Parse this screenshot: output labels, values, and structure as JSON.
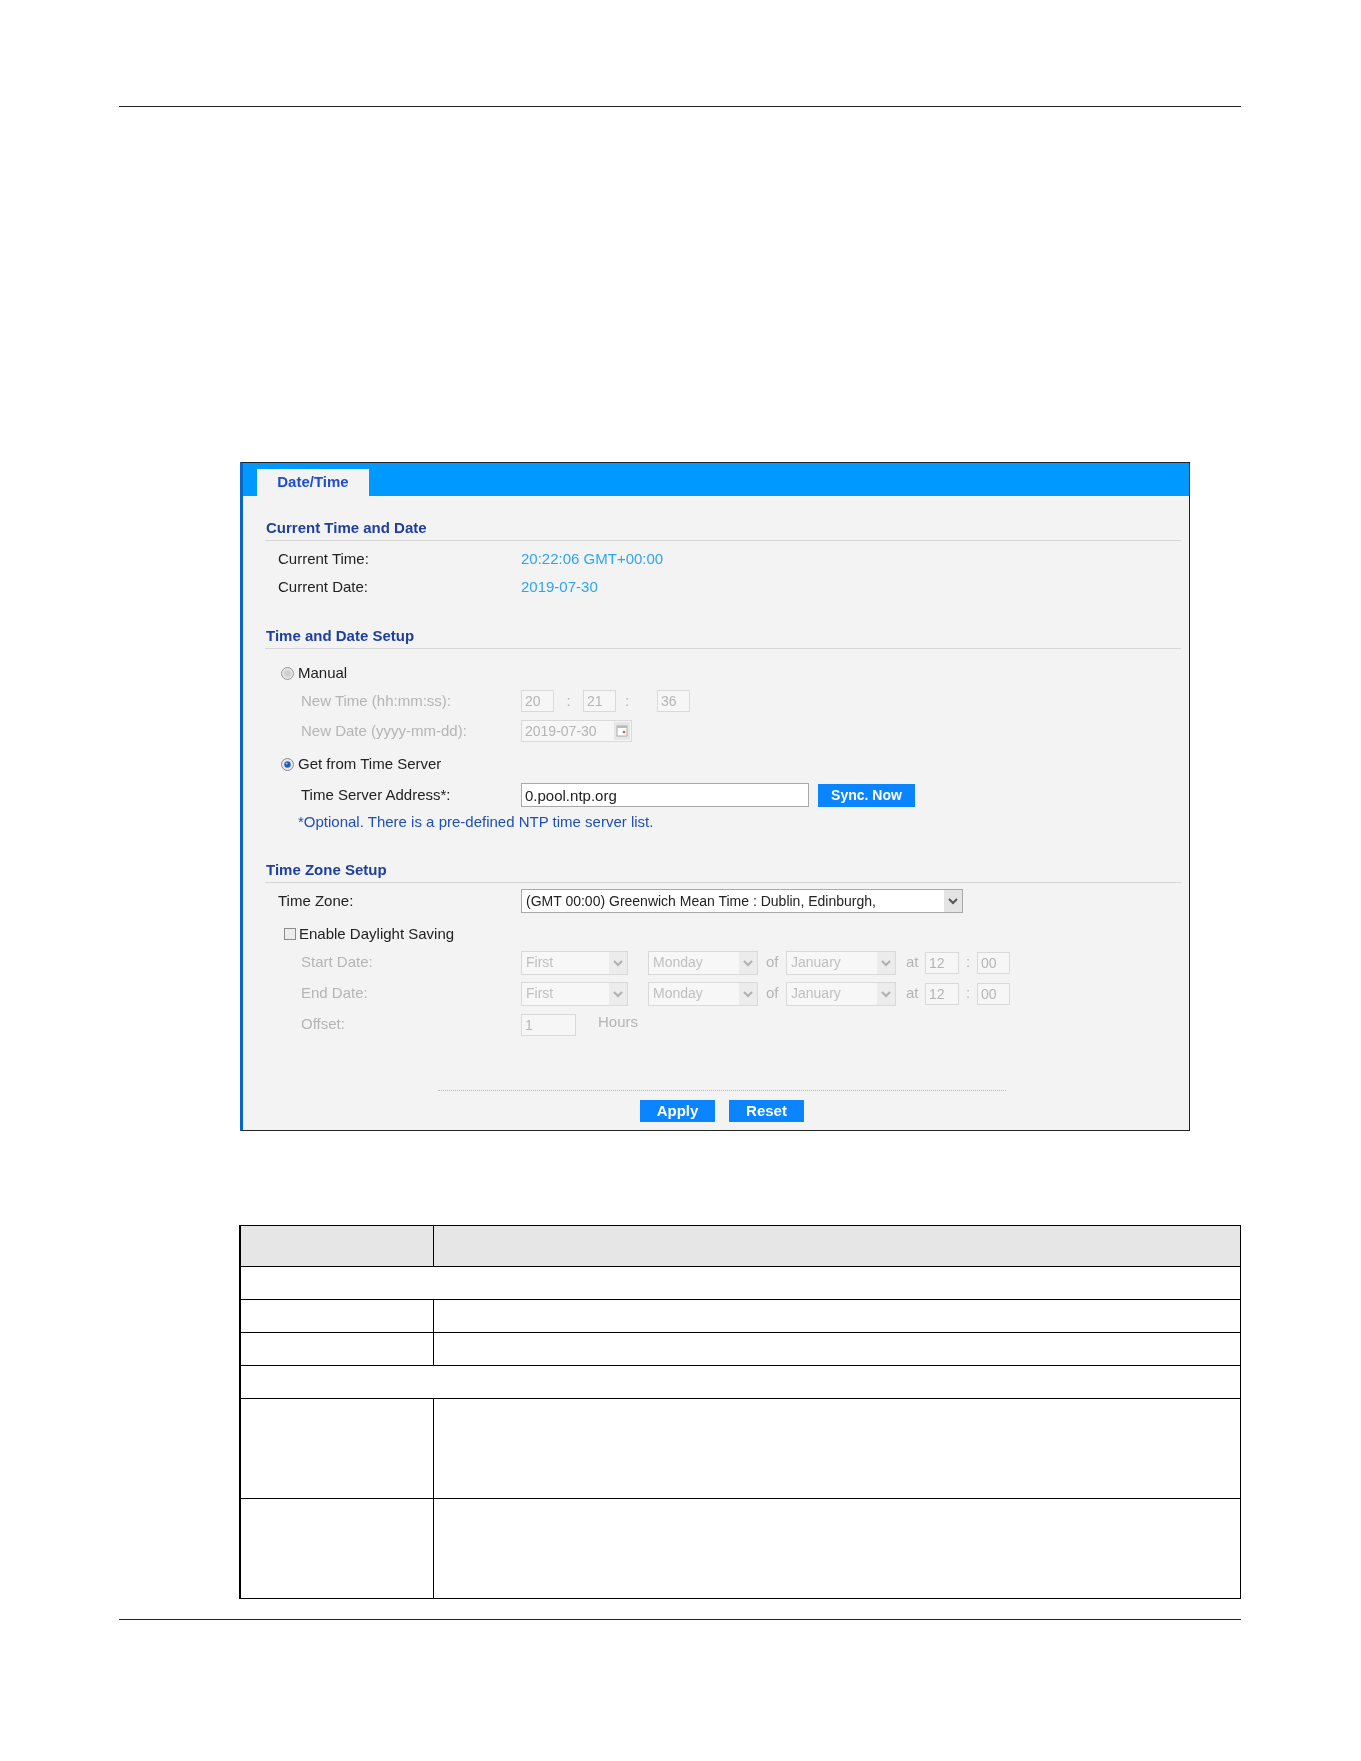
{
  "tabs": [
    {
      "label": "Date/Time",
      "selected": true
    }
  ],
  "current_time_and_date": {
    "title": "Current Time and Date",
    "rows": [
      {
        "label": "Current Time:",
        "value": "20:22:06 GMT+00:00"
      },
      {
        "label": "Current Date:",
        "value": "2019-07-30"
      }
    ]
  },
  "time_and_date_setup": {
    "title": "Time and Date Setup",
    "modes": [
      {
        "label": "Manual",
        "selected": false,
        "fields": [
          {
            "kind": "time",
            "label": "New Time (hh:mm:ss):",
            "values": [
              "20",
              "21",
              "36"
            ],
            "separators": [
              ":",
              ":"
            ]
          },
          {
            "kind": "date",
            "label": "New Date (yyyy-mm-dd):",
            "value": "2019-07-30"
          }
        ]
      },
      {
        "label": "Get from Time Server",
        "selected": true,
        "fields": [
          {
            "kind": "server",
            "label": "Time Server Address*:",
            "value": "0.pool.ntp.org",
            "button": "Sync. Now"
          },
          {
            "kind": "note",
            "text": "*Optional. There is a pre-defined NTP time server list."
          }
        ]
      }
    ]
  },
  "time_zone_setup": {
    "title": "Time Zone Setup",
    "time_zone": {
      "label": "Time Zone:",
      "value": "(GMT 00:00) Greenwich Mean Time : Dublin, Edinburgh,"
    },
    "daylight_saving": {
      "label": "Enable Daylight Saving",
      "checked": false,
      "rows": [
        {
          "kind": "date_rule",
          "label": "Start Date:",
          "week": "First",
          "day": "Monday",
          "of_label": "of",
          "month": "January",
          "at_label": "at",
          "hour": "12",
          "separator": ":",
          "minute": "00"
        },
        {
          "kind": "date_rule",
          "label": "End Date:",
          "week": "First",
          "day": "Monday",
          "of_label": "of",
          "month": "January",
          "at_label": "at",
          "hour": "12",
          "separator": ":",
          "minute": "00"
        },
        {
          "kind": "offset",
          "label": "Offset:",
          "value": "1",
          "unit": "Hours"
        }
      ]
    }
  },
  "buttons": [
    "Apply",
    "Reset"
  ],
  "table": {
    "rows": [
      {
        "kind": "header"
      },
      {
        "kind": "section"
      },
      {
        "kind": "row"
      },
      {
        "kind": "row"
      },
      {
        "kind": "section"
      },
      {
        "kind": "tall_row"
      },
      {
        "kind": "tall_row"
      }
    ]
  }
}
